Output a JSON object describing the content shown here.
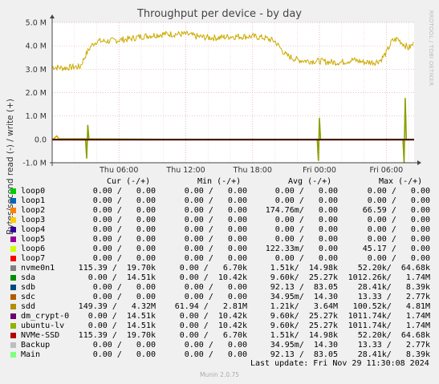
{
  "chart_data": {
    "type": "line",
    "title": "Throughput per device - by day",
    "ylabel": "Bytes/second read (-) / write (+)",
    "ylim": [
      -1000000,
      5000000
    ],
    "yticks": [
      {
        "label": "5.0 M",
        "value": 5000000
      },
      {
        "label": "4.0 M",
        "value": 4000000
      },
      {
        "label": "3.0 M",
        "value": 3000000
      },
      {
        "label": "2.0 M",
        "value": 2000000
      },
      {
        "label": "1.0 M",
        "value": 1000000
      },
      {
        "label": "0.0",
        "value": 0
      },
      {
        "label": "-1.0 M",
        "value": -1000000
      }
    ],
    "xlim": [
      0,
      32.5
    ],
    "xticks": [
      {
        "label": "Thu 06:00",
        "value": 6
      },
      {
        "label": "Thu 12:00",
        "value": 12
      },
      {
        "label": "Thu 18:00",
        "value": 18
      },
      {
        "label": "Fri 00:00",
        "value": 24
      },
      {
        "label": "Fri 06:00",
        "value": 30
      }
    ],
    "grid": true,
    "series": [
      {
        "name": "sdd",
        "color": "#ccaa00",
        "points": [
          [
            0,
            3.1
          ],
          [
            1,
            3.05
          ],
          [
            2,
            3.1
          ],
          [
            2.5,
            3.1
          ],
          [
            3,
            3.6
          ],
          [
            3.5,
            4.0
          ],
          [
            4,
            4.2
          ],
          [
            5,
            4.2
          ],
          [
            6,
            4.25
          ],
          [
            7,
            4.3
          ],
          [
            8,
            4.4
          ],
          [
            9,
            4.45
          ],
          [
            10,
            4.5
          ],
          [
            11,
            4.5
          ],
          [
            12,
            4.5
          ],
          [
            13,
            4.4
          ],
          [
            14,
            4.35
          ],
          [
            15,
            4.35
          ],
          [
            16,
            4.4
          ],
          [
            17,
            4.4
          ],
          [
            18,
            4.4
          ],
          [
            19,
            4.35
          ],
          [
            20,
            4.2
          ],
          [
            20.5,
            3.9
          ],
          [
            21,
            3.6
          ],
          [
            22,
            3.4
          ],
          [
            23,
            3.35
          ],
          [
            24,
            3.35
          ],
          [
            25,
            3.3
          ],
          [
            26,
            3.3
          ],
          [
            27,
            3.4
          ],
          [
            28,
            3.3
          ],
          [
            29,
            3.3
          ],
          [
            29.5,
            3.4
          ],
          [
            30,
            3.7
          ],
          [
            30.5,
            4.2
          ],
          [
            31,
            4.3
          ],
          [
            31.5,
            4.1
          ],
          [
            32,
            3.9
          ],
          [
            32.5,
            4.1
          ]
        ]
      },
      {
        "name": "sdd",
        "color": "#ccaa00",
        "points": [
          [
            0,
            0.0
          ],
          [
            0.2,
            0.05
          ],
          [
            0.4,
            0.15
          ],
          [
            0.6,
            0.03
          ],
          [
            10,
            0.0
          ],
          [
            23.9,
            0.0
          ],
          [
            24,
            0.0
          ],
          [
            32,
            0.0
          ]
        ]
      },
      {
        "name": "ubuntu-lv",
        "color": "#8aa000",
        "points": [
          [
            0,
            0.0
          ],
          [
            3,
            0.0
          ],
          [
            3.1,
            -0.8
          ],
          [
            3.2,
            0.6
          ],
          [
            3.3,
            0.0
          ],
          [
            23.8,
            0.0
          ],
          [
            23.9,
            -0.9
          ],
          [
            24,
            0.9
          ],
          [
            24.1,
            0.0
          ],
          [
            31.5,
            0.0
          ],
          [
            31.6,
            -1.0
          ],
          [
            31.7,
            1.75
          ],
          [
            31.8,
            0.0
          ],
          [
            32.5,
            0.0
          ]
        ]
      },
      {
        "name": "NVMe-SSD",
        "color": "#880000",
        "points": [
          [
            0,
            -0.02
          ],
          [
            32.5,
            -0.02
          ]
        ]
      }
    ],
    "legend": {
      "headers": {
        "cur": "Cur (-/+)",
        "min": "Min (-/+)",
        "avg": "Avg (-/+)",
        "max": "Max (-/+)"
      },
      "rows": [
        {
          "name": "loop0",
          "color": "#00cc00",
          "cur": "0.00 /   0.00",
          "min": "0.00 /   0.00",
          "avg": "0.00 /   0.00",
          "max": "0.00 /   0.00"
        },
        {
          "name": "loop1",
          "color": "#0066b3",
          "cur": "0.00 /   0.00",
          "min": "0.00 /   0.00",
          "avg": "0.00 /   0.00",
          "max": "0.00 /   0.00"
        },
        {
          "name": "loop2",
          "color": "#ff8000",
          "cur": "0.00 /   0.00",
          "min": "0.00 /   0.00",
          "avg": "174.76m/   0.00",
          "max": "66.59 /   0.00"
        },
        {
          "name": "loop3",
          "color": "#ffcc00",
          "cur": "0.00 /   0.00",
          "min": "0.00 /   0.00",
          "avg": "0.00 /   0.00",
          "max": "0.00 /   0.00"
        },
        {
          "name": "loop4",
          "color": "#330099",
          "cur": "0.00 /   0.00",
          "min": "0.00 /   0.00",
          "avg": "0.00 /   0.00",
          "max": "0.00 /   0.00"
        },
        {
          "name": "loop5",
          "color": "#990099",
          "cur": "0.00 /   0.00",
          "min": "0.00 /   0.00",
          "avg": "0.00 /   0.00",
          "max": "0.00 /   0.00"
        },
        {
          "name": "loop6",
          "color": "#ccff00",
          "cur": "0.00 /   0.00",
          "min": "0.00 /   0.00",
          "avg": "122.33m/   0.00",
          "max": "45.17 /   0.00"
        },
        {
          "name": "loop7",
          "color": "#ff0000",
          "cur": "0.00 /   0.00",
          "min": "0.00 /   0.00",
          "avg": "0.00 /   0.00",
          "max": "0.00 /   0.00"
        },
        {
          "name": "nvme0n1",
          "color": "#808080",
          "cur": "115.39 /  19.70k",
          "min": "0.00 /   6.70k",
          "avg": "1.51k/  14.98k",
          "max": "52.20k/  64.68k"
        },
        {
          "name": "sda",
          "color": "#008f00",
          "cur": "0.00 /  14.51k",
          "min": "0.00 /  10.42k",
          "avg": "9.60k/  25.27k",
          "max": "1012.26k/   1.74M"
        },
        {
          "name": "sdb",
          "color": "#00487d",
          "cur": "0.00 /   0.00",
          "min": "0.00 /   0.00",
          "avg": "92.13 /  83.05",
          "max": "28.41k/   8.39k"
        },
        {
          "name": "sdc",
          "color": "#b35a00",
          "cur": "0.00 /   0.00",
          "min": "0.00 /   0.00",
          "avg": "34.95m/  14.30",
          "max": "13.33 /   2.77k"
        },
        {
          "name": "sdd",
          "color": "#b38f00",
          "cur": "149.39 /   4.32M",
          "min": "61.94 /   2.81M",
          "avg": "1.21k/   3.64M",
          "max": "100.52k/   4.81M"
        },
        {
          "name": "dm_crypt-0",
          "color": "#6b006b",
          "cur": "0.00 /  14.51k",
          "min": "0.00 /  10.42k",
          "avg": "9.60k/  25.27k",
          "max": "1011.74k/   1.74M"
        },
        {
          "name": "ubuntu-lv",
          "color": "#8fb300",
          "cur": "0.00 /  14.51k",
          "min": "0.00 /  10.42k",
          "avg": "9.60k/  25.27k",
          "max": "1011.74k/   1.74M"
        },
        {
          "name": "NVMe-SSD",
          "color": "#b30000",
          "cur": "115.39 /  19.70k",
          "min": "0.00 /   6.70k",
          "avg": "1.51k/  14.98k",
          "max": "52.20k/  64.68k"
        },
        {
          "name": "Backup",
          "color": "#bebebe",
          "cur": "0.00 /   0.00",
          "min": "0.00 /   0.00",
          "avg": "34.95m/  14.30",
          "max": "13.33 /   2.77k"
        },
        {
          "name": "Main",
          "color": "#80ff80",
          "cur": "0.00 /   0.00",
          "min": "0.00 /   0.00",
          "avg": "92.13 /  83.05",
          "max": "28.41k/   8.39k"
        }
      ]
    }
  },
  "last_update": "Last update: Fri Nov 29 11:30:08 2024",
  "side_label": "RRDTOOL / TOBI OETIKER",
  "footer": "Munin 2.0.75"
}
